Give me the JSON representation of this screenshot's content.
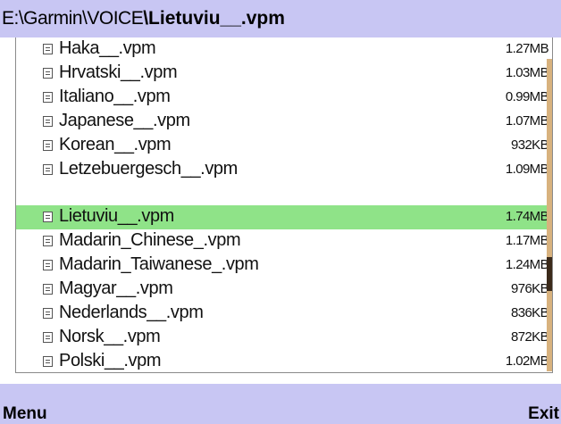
{
  "header": {
    "path": "E:\\Garmin\\VOICE",
    "current_file": "\\Lietuviu__.vpm"
  },
  "files": [
    {
      "name": "Haka__.vpm",
      "size": "1.27MB"
    },
    {
      "name": "Hrvatski__.vpm",
      "size": "1.03MB"
    },
    {
      "name": "Italiano__.vpm",
      "size": "0.99MB"
    },
    {
      "name": "Japanese__.vpm",
      "size": "1.07MB"
    },
    {
      "name": "Korean__.vpm",
      "size": "932KB"
    },
    {
      "name": "Letzebuergesch__.vpm",
      "size": "1.09MB"
    },
    {
      "name": "Lietuviu__.vpm",
      "size": "1.74MB"
    },
    {
      "name": "Madarin_Chinese_.vpm",
      "size": "1.17MB"
    },
    {
      "name": "Madarin_Taiwanese_.vpm",
      "size": "1.24MB"
    },
    {
      "name": "Magyar__.vpm",
      "size": "976KB"
    },
    {
      "name": "Nederlands__.vpm",
      "size": "836KB"
    },
    {
      "name": "Norsk__.vpm",
      "size": "872KB"
    },
    {
      "name": "Polski__.vpm",
      "size": "1.02MB"
    }
  ],
  "selected_file": "Lietuviu__.vpm",
  "colors": {
    "header_background": "#c8c6f3",
    "selection_highlight": "#8fe388",
    "scrollbar_track": "#d8b27e",
    "scrollbar_thumb": "#3b2a1a"
  },
  "softkeys": {
    "left_label": "Menu",
    "right_label": "Exit"
  }
}
